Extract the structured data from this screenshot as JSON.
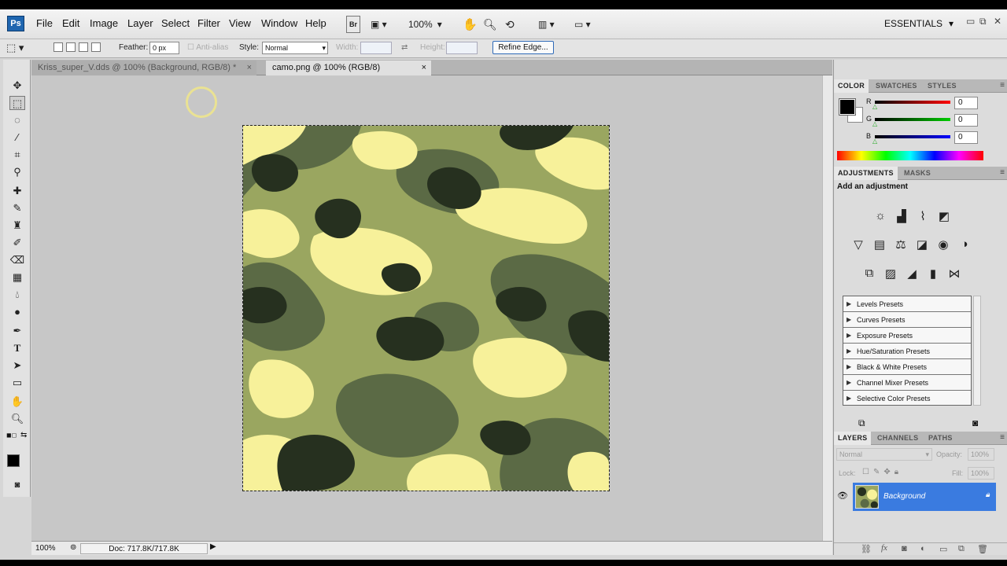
{
  "app": {
    "logo": "Ps"
  },
  "menu": [
    "File",
    "Edit",
    "Image",
    "Layer",
    "Select",
    "Filter",
    "View",
    "Window",
    "Help"
  ],
  "appbar": {
    "bridge": "Br",
    "zoom": "100%",
    "workspace": "ESSENTIALS"
  },
  "options": {
    "feather_label": "Feather:",
    "feather_value": "0 px",
    "antialias_label": "Anti-alias",
    "style_label": "Style:",
    "style_value": "Normal",
    "width_label": "Width:",
    "height_label": "Height:",
    "refine_edge": "Refine Edge..."
  },
  "documents": {
    "tab1": "Kriss_super_V.dds @ 100% (Background, RGB/8) *",
    "tab2": "camo.png @ 100% (RGB/8)"
  },
  "status": {
    "zoom": "100%",
    "doc": "Doc: 717.8K/717.8K"
  },
  "color_panel": {
    "tabs": [
      "COLOR",
      "SWATCHES",
      "STYLES"
    ],
    "channels": [
      {
        "label": "R",
        "value": "0"
      },
      {
        "label": "G",
        "value": "0"
      },
      {
        "label": "B",
        "value": "0"
      }
    ]
  },
  "adjustments_panel": {
    "tabs": [
      "ADJUSTMENTS",
      "MASKS"
    ],
    "heading": "Add an adjustment",
    "presets": [
      "Levels Presets",
      "Curves Presets",
      "Exposure Presets",
      "Hue/Saturation Presets",
      "Black & White Presets",
      "Channel Mixer Presets",
      "Selective Color Presets"
    ]
  },
  "layers_panel": {
    "tabs": [
      "LAYERS",
      "CHANNELS",
      "PATHS"
    ],
    "blend_mode": "Normal",
    "opacity_label": "Opacity:",
    "opacity_value": "100%",
    "lock_label": "Lock:",
    "fill_label": "Fill:",
    "fill_value": "100%",
    "layer_name": "Background"
  },
  "colors": {
    "camo_light": "#f7f19a",
    "camo_mid": "#9aa660",
    "camo_dark": "#5b6a45",
    "camo_darkest": "#26301f",
    "selection": "#3a7be0"
  }
}
